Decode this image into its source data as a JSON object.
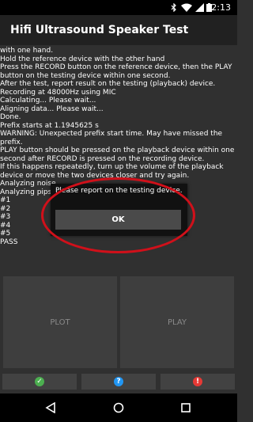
{
  "status_bar": {
    "time": "2:13"
  },
  "app": {
    "title": "Hifi Ultrasound Speaker Test"
  },
  "log_lines": [
    "with one hand.",
    " Hold the reference device with the other hand",
    " Press the RECORD button on the reference device, then the PLAY",
    "button on the testing device within one second.",
    " After the test, report result on the testing (playback) device.",
    "Recording at 48000Hz using MIC",
    "Calculating... Please wait...",
    "Aligning data... Please wait...",
    "Done.",
    "Prefix starts at 1.1945625 s",
    "WARNING: Unexpected prefix start time. May have missed the",
    "prefix.",
    "PLAY button should be pressed on the playback device within one",
    "second after RECORD is pressed on the recording device.",
    "If this happens repeatedly, turn up the volume of the playback",
    "device or move the two devices closer and try again.",
    "Analyzing noise...",
    "Analyzing pips...",
    "#1",
    "#2",
    "#3",
    "#4",
    "#5",
    "PASS"
  ],
  "buttons": {
    "plot": "PLOT",
    "play": "PLAY"
  },
  "result_buttons": {
    "pass_symbol": "✓",
    "info_symbol": "?",
    "fail_symbol": "!"
  },
  "colors": {
    "pass": "#4caf50",
    "info": "#2196f3",
    "fail": "#e53935",
    "annotation": "#d0101a"
  },
  "dialog": {
    "message": "Please report on the testing device.",
    "ok_label": "OK"
  },
  "icons": [
    "bluetooth-icon",
    "wifi-icon",
    "signal-icon",
    "battery-icon",
    "back-icon",
    "home-icon",
    "recents-icon"
  ]
}
